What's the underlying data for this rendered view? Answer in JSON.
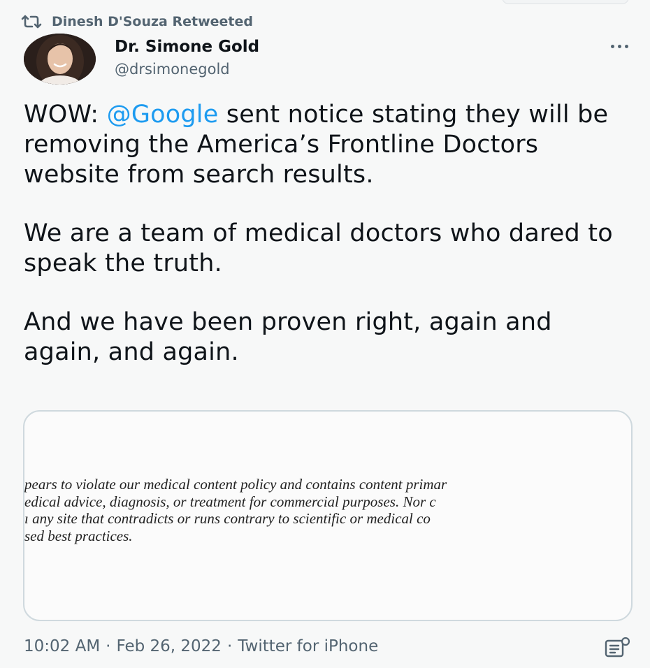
{
  "retweet": {
    "icon": "retweet-icon",
    "text": "Dinesh D'Souza Retweeted"
  },
  "author": {
    "display_name": "Dr. Simone Gold",
    "handle": "@drsimonegold",
    "avatar": "profile-photo"
  },
  "tweet": {
    "para1_before": "WOW: ",
    "mention": "@Google",
    "para1_after": " sent notice stating they will be removing the America’s Frontline Doctors website from search results.",
    "para2": "We are a team of medical doctors who dared to speak the truth.",
    "para3": "And we have been proven right, again and again, and again."
  },
  "media": {
    "lines": [
      "pears to violate our medical content policy and contains content primar",
      "edical advice, diagnosis, or treatment for commercial purposes. Nor c",
      "ı any site that contradicts or runs contrary to scientific or medical co",
      "sed best practices."
    ]
  },
  "meta": {
    "time": "10:02 AM",
    "separator": "·",
    "date": "Feb 26, 2022",
    "source": "Twitter for iPhone"
  },
  "colors": {
    "link": "#1d9bf0",
    "secondary_text": "#536471",
    "background": "#f7f8f8",
    "card_border": "#cfd9de"
  }
}
